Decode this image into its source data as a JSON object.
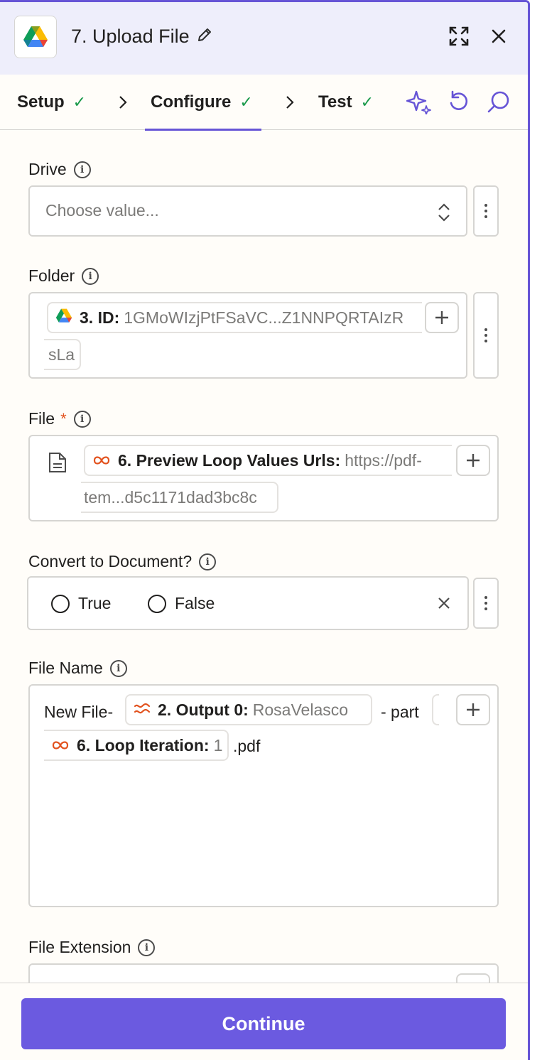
{
  "header": {
    "step_title": "7. Upload File",
    "icons": [
      "google-drive-icon",
      "pencil-icon",
      "expand-icon",
      "close-icon"
    ]
  },
  "tabs": [
    {
      "label": "Setup",
      "done": true
    },
    {
      "label": "Configure",
      "done": true,
      "active": true
    },
    {
      "label": "Test",
      "done": true
    }
  ],
  "toolbar": {
    "icons": [
      "sparkle-icon",
      "refresh-icon",
      "search-icon"
    ]
  },
  "fields": {
    "drive": {
      "label": "Drive",
      "placeholder": "Choose value..."
    },
    "folder": {
      "label": "Folder",
      "pill_label": "3. ID:",
      "pill_value": "1GMoWIzjPtFSaVC...Z1NNPQRTAIzR",
      "pill_wrap": "sLa"
    },
    "file": {
      "label": "File",
      "required": "*",
      "pill_label": "6. Preview Loop Values Urls:",
      "pill_value": "https://pdf-",
      "pill_wrap": "tem...d5c1171dad3bc8c"
    },
    "convert": {
      "label": "Convert to Document?",
      "options": [
        "True",
        "False"
      ]
    },
    "file_name": {
      "label": "File Name",
      "prefix": "New File-",
      "pill1_label": "2. Output 0:",
      "pill1_value": "RosaVelasco",
      "middle": "- part",
      "pill2_label": "6. Loop Iteration:",
      "pill2_value": "1",
      "suffix": ".pdf"
    },
    "file_extension": {
      "label": "File Extension"
    }
  },
  "footer": {
    "continue_label": "Continue"
  },
  "colors": {
    "accent": "#6654d6",
    "success": "#1a9a4b",
    "required": "#e2521e",
    "loop": "#e2521e"
  }
}
